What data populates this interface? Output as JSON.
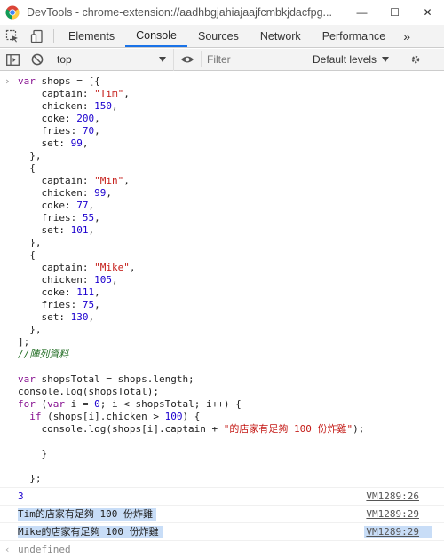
{
  "window": {
    "title": "DevTools - chrome-extension://aadhbgjahiajaajfcmbkjdacfpg...",
    "minimize": "—",
    "maximize": "☐",
    "close": "✕"
  },
  "tabs": {
    "elements": "Elements",
    "console": "Console",
    "sources": "Sources",
    "network": "Network",
    "performance": "Performance",
    "more": "»"
  },
  "toolbar": {
    "context": "top",
    "filter_placeholder": "Filter",
    "levels": "Default levels"
  },
  "code": [
    "var shops = [{",
    "    captain: \"Tim\",",
    "    chicken: 150,",
    "    coke: 200,",
    "    fries: 70,",
    "    set: 99,",
    "  },",
    "  {",
    "    captain: \"Min\",",
    "    chicken: 99,",
    "    coke: 77,",
    "    fries: 55,",
    "    set: 101,",
    "  },",
    "  {",
    "    captain: \"Mike\",",
    "    chicken: 105,",
    "    coke: 111,",
    "    fries: 75,",
    "    set: 130,",
    "  },",
    "];",
    "//陣列資料",
    "",
    "var shopsTotal = shops.length;",
    "console.log(shopsTotal);",
    "for (var i = 0; i < shopsTotal; i++) {",
    "  if (shops[i].chicken > 100) {",
    "    console.log(shops[i].captain + \"的店家有足夠 100 份炸雞\");",
    "",
    "    }",
    "",
    "  };"
  ],
  "logs": [
    {
      "text": "3",
      "source": "VM1289:26"
    },
    {
      "text": "Tim的店家有足夠 100 份炸雞",
      "source": "VM1289:29"
    },
    {
      "text": "Mike的店家有足夠 100 份炸雞",
      "source": "VM1289:29"
    }
  ],
  "result": "undefined",
  "colors": {
    "keyword": "#881391",
    "string": "#c41a16",
    "number": "#1c00cf",
    "comment": "#236e25",
    "highlight": "#c8ddf7",
    "active_tab": "#1a73e8"
  }
}
